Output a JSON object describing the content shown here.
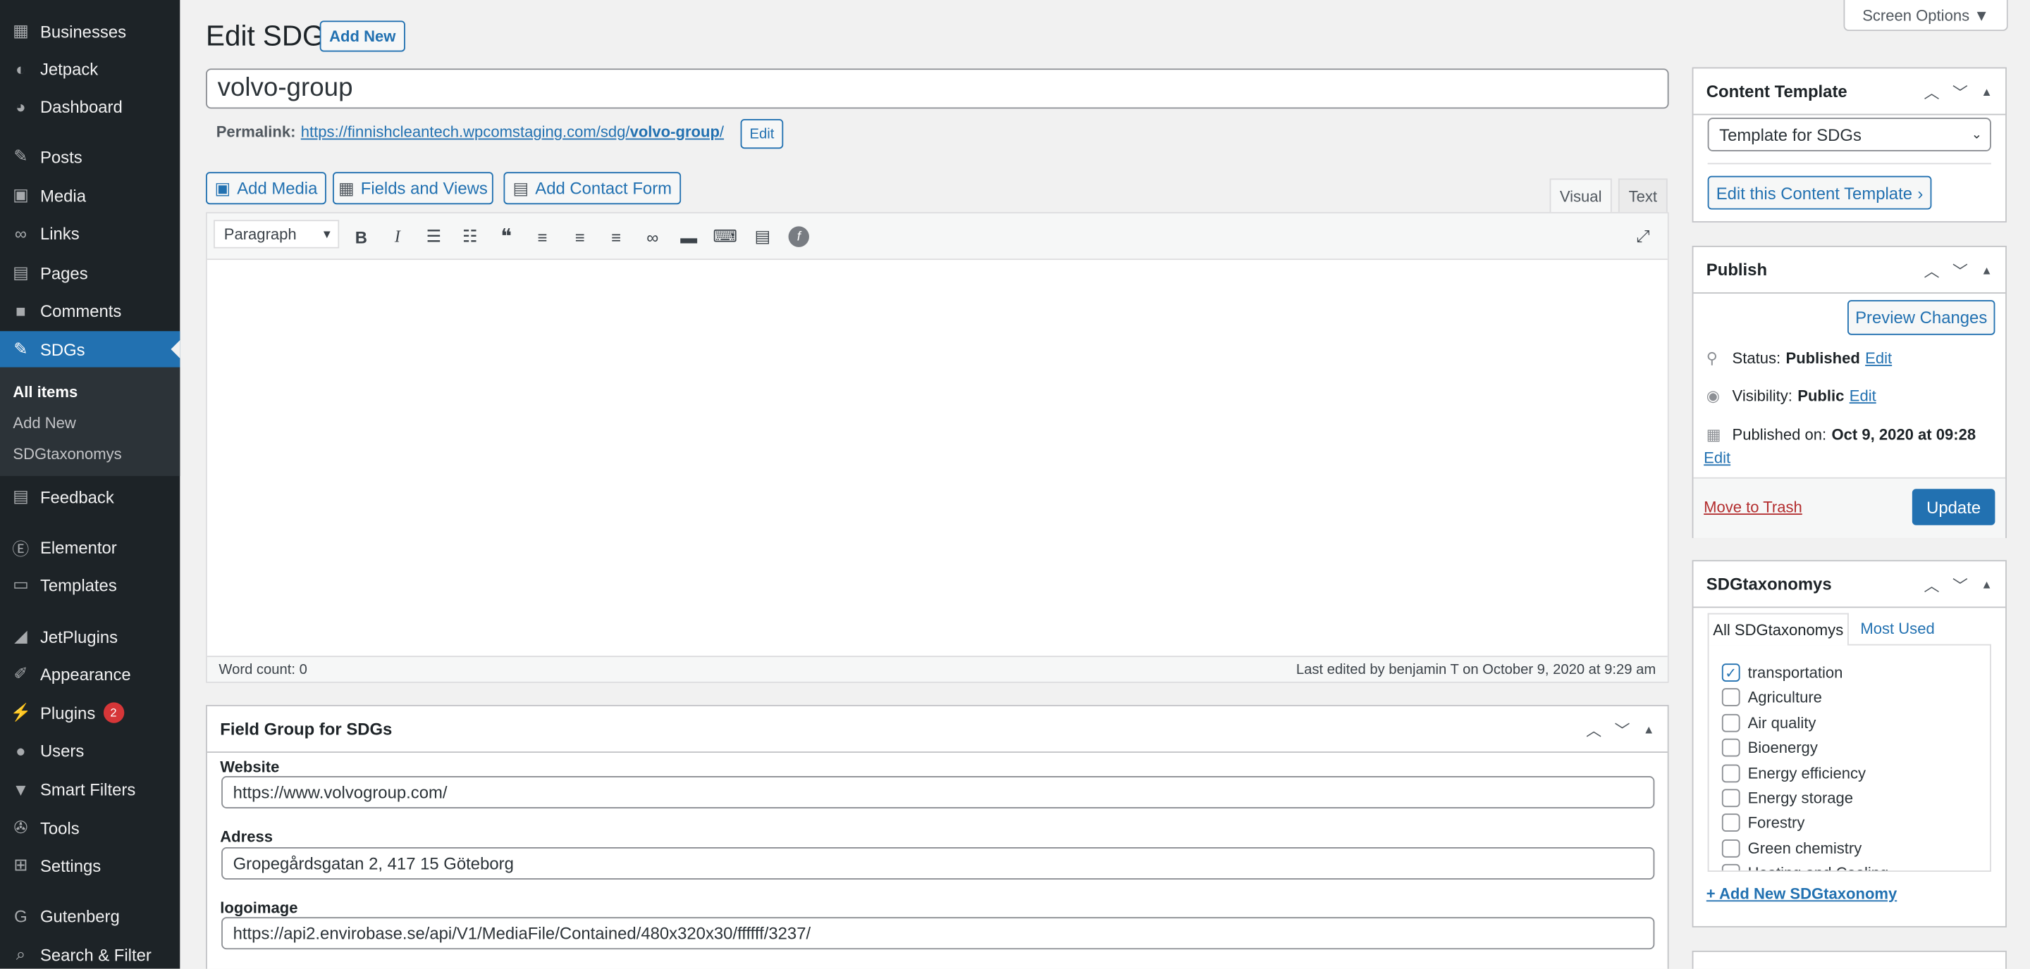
{
  "sidebar": {
    "items": [
      {
        "label": "Businesses",
        "icon": "building-icon"
      },
      {
        "label": "Jetpack",
        "icon": "jetpack-icon"
      },
      {
        "label": "Dashboard",
        "icon": "dashboard-icon"
      },
      {
        "label": "Posts",
        "icon": "pin-icon"
      },
      {
        "label": "Media",
        "icon": "media-icon"
      },
      {
        "label": "Links",
        "icon": "link-icon"
      },
      {
        "label": "Pages",
        "icon": "page-icon"
      },
      {
        "label": "Comments",
        "icon": "comment-icon"
      },
      {
        "label": "SDGs",
        "icon": "pin-icon"
      },
      {
        "label": "Feedback",
        "icon": "feedback-icon"
      },
      {
        "label": "Elementor",
        "icon": "elementor-icon"
      },
      {
        "label": "Templates",
        "icon": "folder-icon"
      },
      {
        "label": "JetPlugins",
        "icon": "jetplugins-icon"
      },
      {
        "label": "Appearance",
        "icon": "brush-icon"
      },
      {
        "label": "Plugins",
        "icon": "plugin-icon"
      },
      {
        "label": "Users",
        "icon": "user-icon"
      },
      {
        "label": "Smart Filters",
        "icon": "filter-icon"
      },
      {
        "label": "Tools",
        "icon": "wrench-icon"
      },
      {
        "label": "Settings",
        "icon": "settings-icon"
      },
      {
        "label": "Gutenberg",
        "icon": "gutenberg-icon"
      },
      {
        "label": "Search & Filter",
        "icon": "search-icon"
      }
    ],
    "plugins_badge": "2",
    "submenu": [
      "All items",
      "Add New",
      "SDGtaxonomys"
    ]
  },
  "header": {
    "title": "Edit SDG",
    "add_new": "Add New",
    "screen_options": "Screen Options ▼"
  },
  "post": {
    "title": "volvo-group",
    "permalink_label": "Permalink:",
    "permalink_base": "https://finnishcleantech.wpcomstaging.com/sdg/",
    "permalink_slug": "volvo-group",
    "permalink_end": "/",
    "permalink_edit": "Edit"
  },
  "media_buttons": {
    "add_media": "Add Media",
    "fields_views": "Fields and Views",
    "contact_form": "Add Contact Form"
  },
  "editor": {
    "tab_visual": "Visual",
    "tab_text": "Text",
    "format": "Paragraph",
    "word_count": "Word count: 0",
    "last_edited": "Last edited by benjamin T on October 9, 2020 at 9:29 am"
  },
  "field_group": {
    "title": "Field Group for SDGs",
    "website_label": "Website",
    "website_value": "https://www.volvogroup.com/",
    "adress_label": "Adress",
    "adress_value": "Gropegårdsgatan 2, 417 15 Göteborg",
    "logo_label": "logoimage",
    "logo_value": "https://api2.envirobase.se/api/V1/MediaFile/Contained/480x320x30/ffffff/3237/"
  },
  "content_template": {
    "title": "Content Template",
    "selected": "Template for SDGs",
    "edit_button": "Edit this Content Template"
  },
  "publish": {
    "title": "Publish",
    "preview": "Preview Changes",
    "status_label": "Status:",
    "status_value": "Published",
    "visibility_label": "Visibility:",
    "visibility_value": "Public",
    "published_label": "Published on:",
    "published_value": "Oct 9, 2020 at 09:28",
    "edit": "Edit",
    "trash": "Move to Trash",
    "update": "Update"
  },
  "taxonomy": {
    "title": "SDGtaxonomys",
    "tab_all": "All SDGtaxonomys",
    "tab_most": "Most Used",
    "items": [
      {
        "label": "transportation",
        "checked": true
      },
      {
        "label": "Agriculture",
        "checked": false
      },
      {
        "label": "Air quality",
        "checked": false
      },
      {
        "label": "Bioenergy",
        "checked": false
      },
      {
        "label": "Energy efficiency",
        "checked": false
      },
      {
        "label": "Energy storage",
        "checked": false
      },
      {
        "label": "Forestry",
        "checked": false
      },
      {
        "label": "Green chemistry",
        "checked": false
      },
      {
        "label": "Heating and Cooling",
        "checked": false
      }
    ],
    "add_new": "+ Add New SDGtaxonomy"
  },
  "colors": {
    "accent": "#2271b1",
    "sidebar": "#1d2327",
    "badge": "#d63638",
    "danger": "#b32d2e"
  }
}
